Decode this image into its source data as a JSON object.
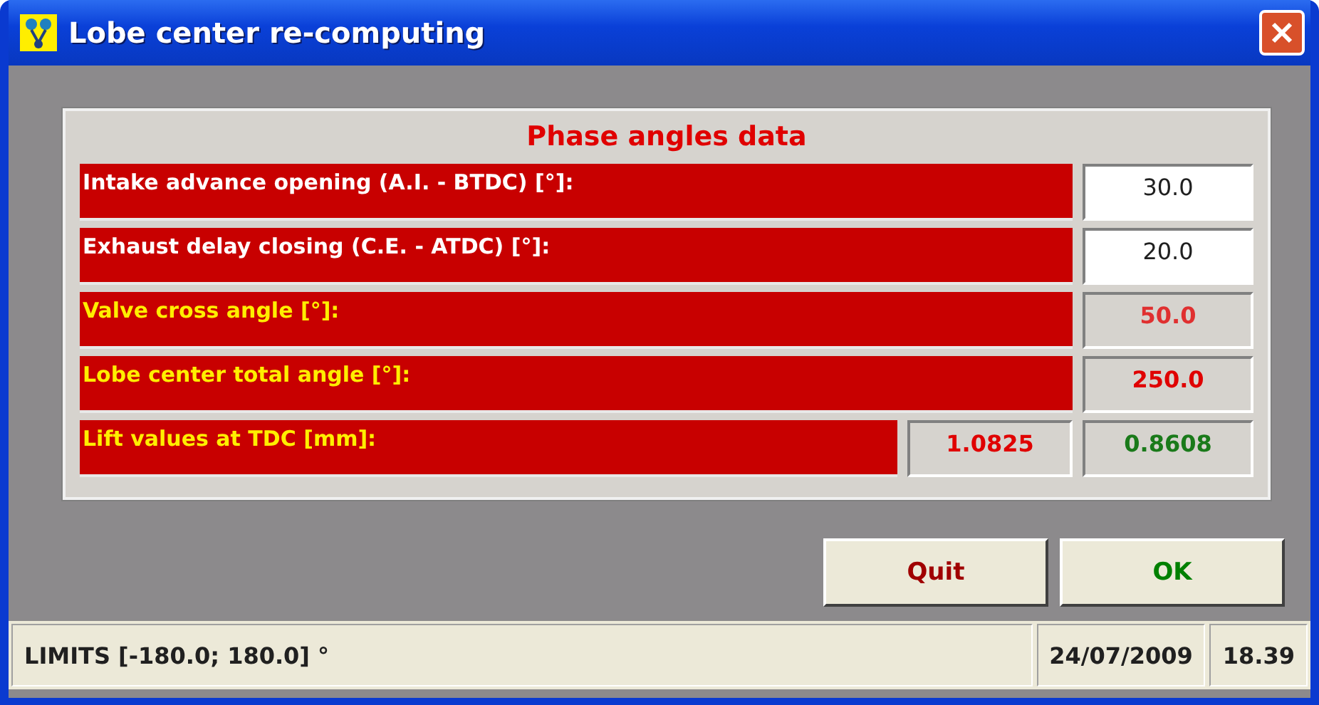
{
  "window": {
    "title": "Lobe center re-computing"
  },
  "panel": {
    "title": "Phase angles data",
    "rows": [
      {
        "kind": "input",
        "label": "Intake advance opening (A.I. - BTDC) [°]:",
        "values": [
          {
            "text": "30.0",
            "color": "#202020"
          }
        ]
      },
      {
        "kind": "input",
        "label": "Exhaust delay closing (C.E. - ATDC) [°]:",
        "values": [
          {
            "text": "20.0",
            "color": "#202020"
          }
        ]
      },
      {
        "kind": "output",
        "label": "Valve cross angle [°]:",
        "values": [
          {
            "text": "50.0",
            "color": "#e03030"
          }
        ]
      },
      {
        "kind": "output",
        "label": "Lobe center total angle [°]:",
        "values": [
          {
            "text": "250.0",
            "color": "#e00000"
          }
        ]
      },
      {
        "kind": "output",
        "label": "Lift values at TDC [mm]:",
        "values": [
          {
            "text": "1.0825",
            "color": "#e00000"
          },
          {
            "text": "0.8608",
            "color": "#1a7a1a"
          }
        ]
      }
    ]
  },
  "buttons": [
    {
      "label": "Quit",
      "color": "#a00000"
    },
    {
      "label": "OK",
      "color": "#008000"
    }
  ],
  "status_bar": [
    "LIMITS [-180.0; 180.0] °",
    "24/07/2009",
    "18.39"
  ]
}
